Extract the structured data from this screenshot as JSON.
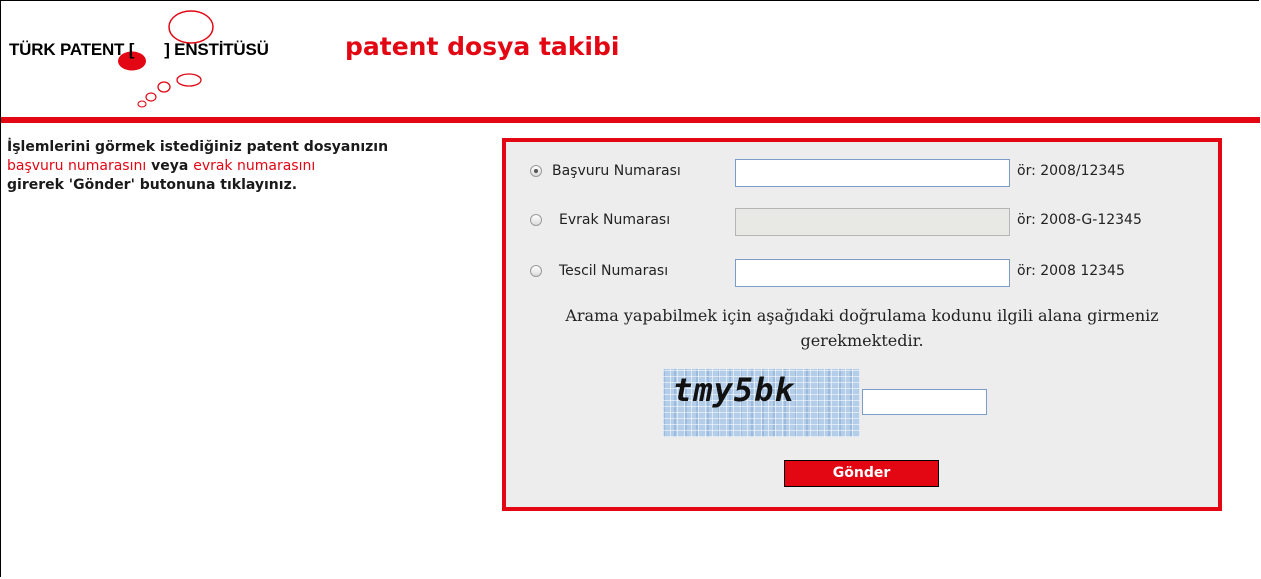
{
  "header": {
    "logo_left": "TÜRK PATENT [",
    "logo_right": "] ENSTİTÜSÜ",
    "title": "patent dosya takibi"
  },
  "instructions": {
    "line1": "İşlemlerini görmek istediğiniz patent dosyanızın",
    "highlight1": "başvuru numarasını",
    "connector": " veya ",
    "highlight2": "evrak numarasını",
    "line3": "girerek 'Gönder' butonuna tıklayınız."
  },
  "form": {
    "rows": [
      {
        "label": "Başvuru Numarası",
        "example": "ör: 2008/12345",
        "value": "",
        "selected": true,
        "disabled": false
      },
      {
        "label": "Evrak Numarası",
        "example": "ör: 2008-G-12345",
        "value": "",
        "selected": false,
        "disabled": true
      },
      {
        "label": "Tescil Numarası",
        "example": "ör: 2008 12345",
        "value": "",
        "selected": false,
        "disabled": false
      }
    ],
    "verify_text": "Arama yapabilmek için aşağıdaki doğrulama kodunu ilgili alana girmeniz gerekmektedir.",
    "captcha_text": "tmy5bk",
    "captcha_value": "",
    "submit_label": "Gönder"
  },
  "colors": {
    "brand_red": "#e30613",
    "form_bg": "#ededed",
    "input_border": "#7a9cc6"
  },
  "icons": {
    "logo": "speech-bubble-logo-icon",
    "radio": "radio-button-icon"
  }
}
